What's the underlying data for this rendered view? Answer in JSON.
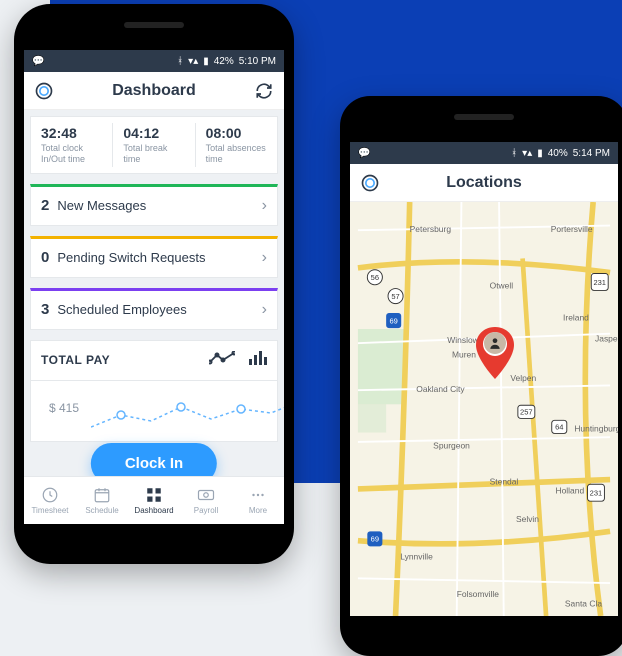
{
  "left": {
    "status": {
      "battery": "42%",
      "time": "5:10 PM"
    },
    "title": "Dashboard",
    "stats": [
      {
        "value": "32:48",
        "label": "Total clock In/Out time"
      },
      {
        "value": "04:12",
        "label": "Total break time"
      },
      {
        "value": "08:00",
        "label": "Total absences time"
      }
    ],
    "rows": [
      {
        "count": "2",
        "text": "New Messages",
        "color": "#1fb658"
      },
      {
        "count": "0",
        "text": "Pending Switch Requests",
        "color": "#f3b200"
      },
      {
        "count": "3",
        "text": "Scheduled Employees",
        "color": "#7b3ff0"
      }
    ],
    "pay": {
      "title": "TOTAL PAY",
      "amount": "$ 415"
    },
    "clockin": "Clock In",
    "tabs": [
      {
        "label": "Timesheet"
      },
      {
        "label": "Schedule"
      },
      {
        "label": "Dashboard"
      },
      {
        "label": "Payroll"
      },
      {
        "label": "More"
      }
    ]
  },
  "right": {
    "status": {
      "battery": "40%",
      "time": "5:14 PM"
    },
    "title": "Locations",
    "places": [
      "Petersburg",
      "Portersville",
      "Otwell",
      "Ireland",
      "Jasper",
      "Winslow",
      "Muren",
      "Velpen",
      "Oakland City",
      "Huntingburg",
      "Spurgeon",
      "Stendal",
      "Holland",
      "Selvin",
      "Lynnville",
      "Folsomville",
      "Santa Cla"
    ],
    "roads": [
      "56",
      "57",
      "69",
      "231",
      "257",
      "64"
    ]
  }
}
